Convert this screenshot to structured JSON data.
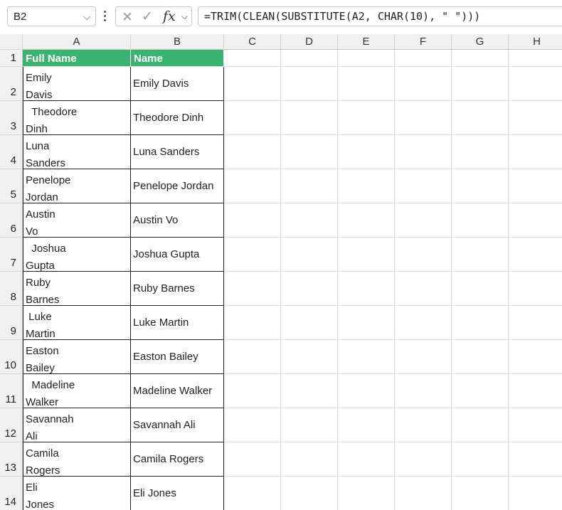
{
  "formula_bar": {
    "name_box": "B2",
    "cancel_icon": "✕",
    "enter_icon": "✓",
    "fx_label": "fx",
    "formula": "=TRIM(CLEAN(SUBSTITUTE(A2, CHAR(10), \" \")))"
  },
  "columns": [
    "A",
    "B",
    "C",
    "D",
    "E",
    "F",
    "G",
    "H"
  ],
  "header_row": {
    "row": "1",
    "a": "Full Name",
    "b": "Name"
  },
  "header_color": "#3cb371",
  "rows": [
    {
      "row": "2",
      "a1": "Emily",
      "a2": "Davis",
      "b": "Emily Davis"
    },
    {
      "row": "3",
      "a1": "  Theodore",
      "a2": "Dinh",
      "b": "Theodore Dinh"
    },
    {
      "row": "4",
      "a1": "Luna",
      "a2": "Sanders",
      "b": "Luna Sanders"
    },
    {
      "row": "5",
      "a1": "Penelope",
      "a2": "Jordan",
      "b": "Penelope Jordan"
    },
    {
      "row": "6",
      "a1": "Austin",
      "a2": "Vo",
      "b": "Austin Vo"
    },
    {
      "row": "7",
      "a1": "  Joshua",
      "a2": "Gupta",
      "b": "Joshua Gupta"
    },
    {
      "row": "8",
      "a1": "Ruby",
      "a2": "Barnes",
      "b": "Ruby Barnes"
    },
    {
      "row": "9",
      "a1": " Luke",
      "a2": "Martin",
      "b": "Luke Martin"
    },
    {
      "row": "10",
      "a1": "Easton",
      "a2": "Bailey",
      "b": "Easton Bailey"
    },
    {
      "row": "11",
      "a1": "  Madeline",
      "a2": "Walker",
      "b": "Madeline Walker"
    },
    {
      "row": "12",
      "a1": "Savannah",
      "a2": "Ali",
      "b": "Savannah Ali"
    },
    {
      "row": "13",
      "a1": "Camila",
      "a2": "Rogers",
      "b": "Camila Rogers"
    },
    {
      "row": "14",
      "a1": "Eli",
      "a2": "Jones",
      "b": "Eli Jones"
    }
  ]
}
